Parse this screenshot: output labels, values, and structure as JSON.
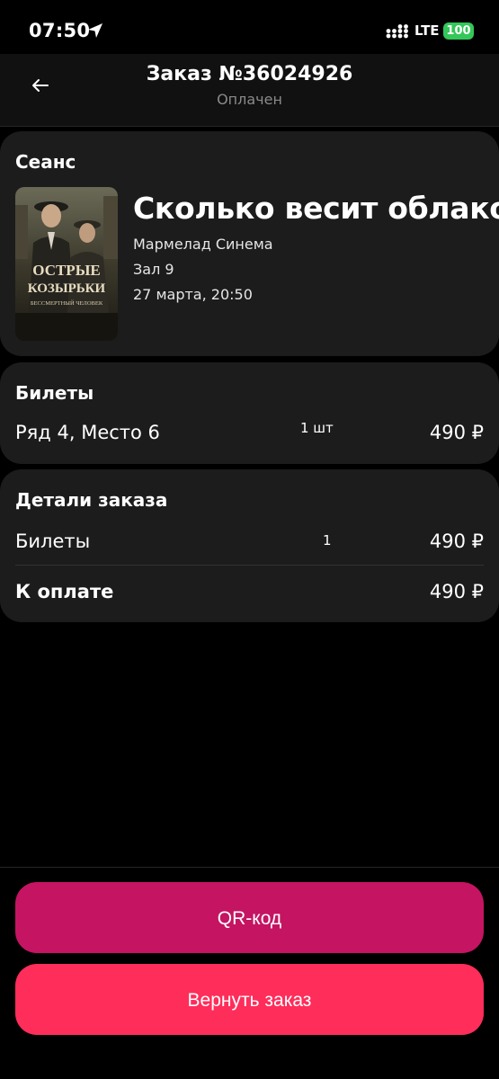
{
  "status_bar": {
    "time": "07:50",
    "network_type": "LTE",
    "battery_level": "100",
    "icons": [
      "location-arrow-icon",
      "signal-icon"
    ],
    "colors": {
      "battery": "#34c759"
    }
  },
  "header": {
    "title": "Заказ №36024926",
    "status": "Оплачен",
    "back_icon": "back-arrow-icon"
  },
  "session": {
    "section_title": "Сеанс",
    "poster": {
      "title_line1": "ОСТРЫЕ",
      "title_line2": "КОЗЫРЬКИ",
      "subtitle": "БЕССМЕРТНЫЙ ЧЕЛОВЕК"
    },
    "movie_title": "Сколько весит облако",
    "cinema": "Мармелад Синема",
    "hall": "Зал 9",
    "datetime": "27 марта, 20:50"
  },
  "tickets": {
    "section_title": "Билеты",
    "items": [
      {
        "label": "Ряд 4, Место 6",
        "quantity": "1 шт",
        "price": "490 ₽"
      }
    ]
  },
  "order_details": {
    "section_title": "Детали заказа",
    "lines": [
      {
        "label": "Билеты",
        "quantity": "1",
        "price": "490 ₽"
      }
    ],
    "total_label": "К оплате",
    "total_price": "490 ₽"
  },
  "actions": {
    "qr_label": "QR-код",
    "refund_label": "Вернуть заказ",
    "colors": {
      "qr": "#c51462",
      "refund": "#ff2d5a"
    }
  }
}
